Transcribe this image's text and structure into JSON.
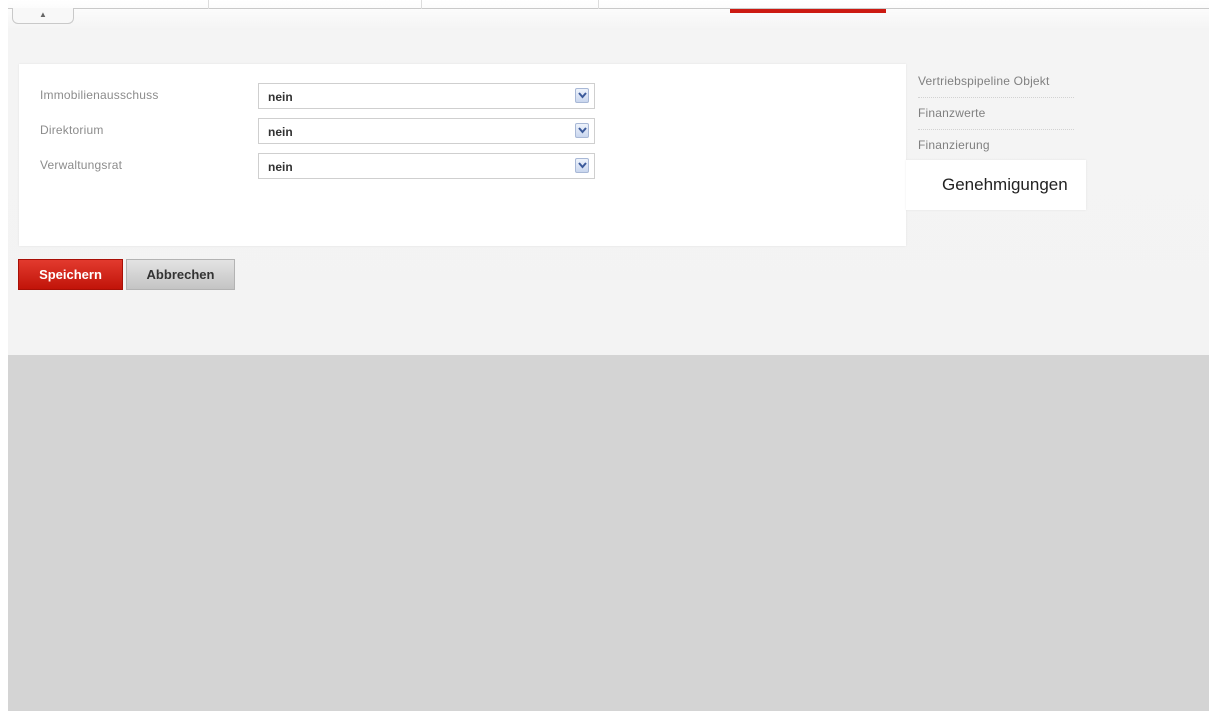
{
  "top_tab": {
    "icon": "up-arrow-icon",
    "glyph": "▲"
  },
  "form": {
    "rows": [
      {
        "label": "Immobilienausschuss",
        "value": "nein"
      },
      {
        "label": "Direktorium",
        "value": "nein"
      },
      {
        "label": "Verwaltungsrat",
        "value": "nein"
      }
    ]
  },
  "actions": {
    "save_label": "Speichern",
    "cancel_label": "Abbrechen"
  },
  "side_nav": {
    "items": [
      {
        "label": "Vertriebspipeline Objekt"
      },
      {
        "label": "Finanzwerte"
      },
      {
        "label": "Finanzierung"
      }
    ],
    "active": {
      "label": "Genehmigungen"
    }
  },
  "colors": {
    "accent": "#cc1a12",
    "background": "#d4d4d4",
    "panel": "#f3f3f3"
  }
}
